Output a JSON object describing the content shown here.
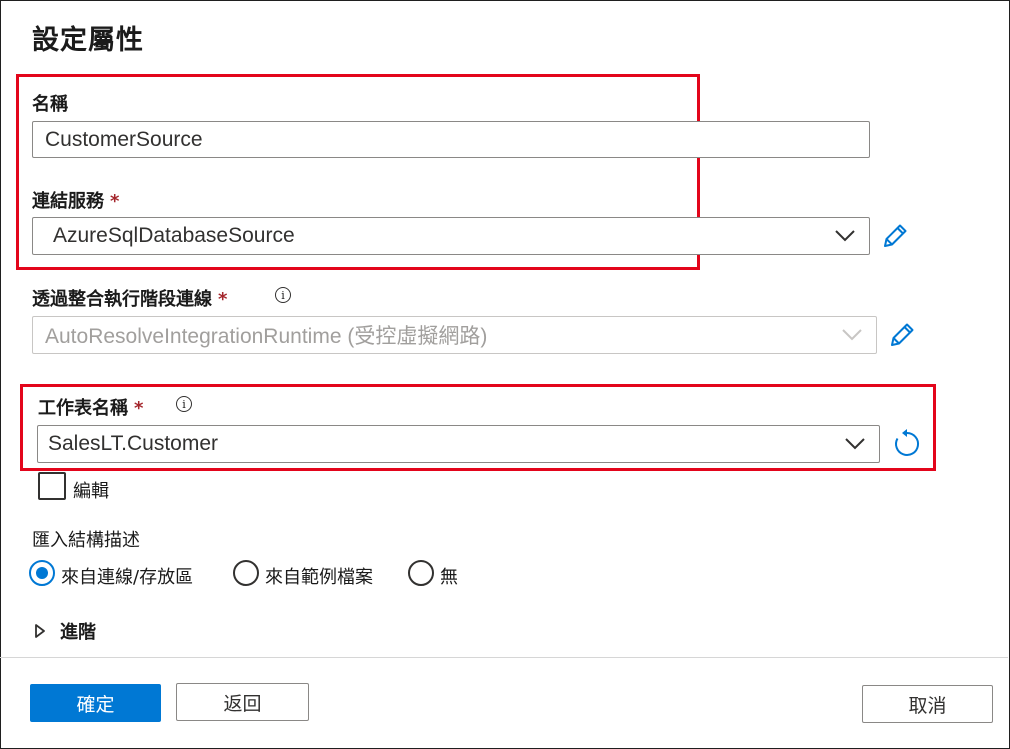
{
  "panel": {
    "title": "設定屬性"
  },
  "name_field": {
    "label": "名稱",
    "value": "CustomerSource"
  },
  "linked_service": {
    "label": "連結服務",
    "required": "*",
    "value": "AzureSqlDatabaseSource"
  },
  "integration_runtime": {
    "label": "透過整合執行階段連線",
    "required": "*",
    "value": "AutoResolveIntegrationRuntime (受控虛擬網路)"
  },
  "table_name": {
    "label": "工作表名稱",
    "required": "*",
    "value": "SalesLT.Customer",
    "edit_label": "編輯",
    "edit_checked": false
  },
  "import_schema": {
    "label": "匯入結構描述",
    "options": [
      "來自連線/存放區",
      "來自範例檔案",
      "無"
    ],
    "selected": "來自連線/存放區"
  },
  "advanced": {
    "label": "進階"
  },
  "footer": {
    "ok": "確定",
    "back": "返回",
    "cancel": "取消"
  },
  "icons": {
    "edit": "pencil-icon",
    "refresh": "refresh-icon",
    "info": "info-icon",
    "dropdown": "chevron-down-icon",
    "expand": "caret-right-icon"
  },
  "colors": {
    "accent": "#0078d4",
    "highlight": "#e3051b",
    "required": "#a4262c"
  }
}
